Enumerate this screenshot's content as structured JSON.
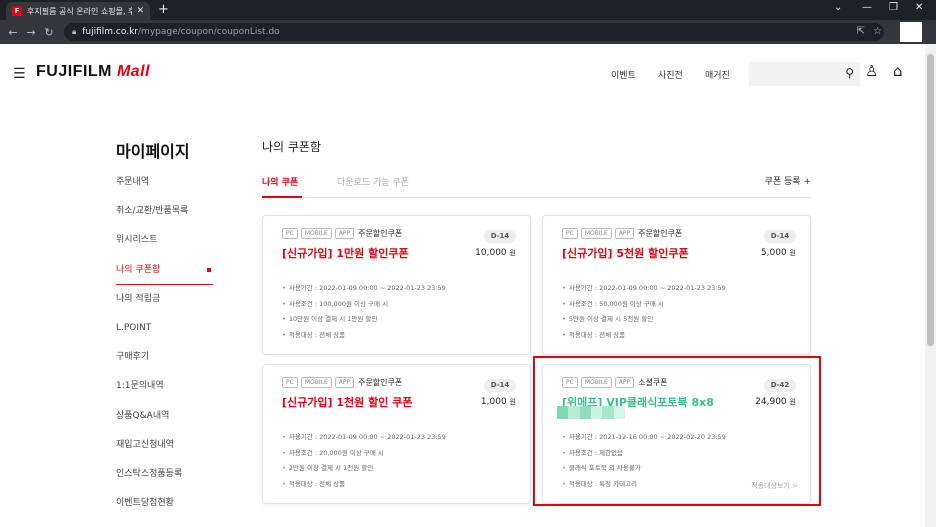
{
  "browser": {
    "tab_title": "후지필름 공식 온라인 쇼핑몰, 후",
    "tab_favicon": "F",
    "url_host": "fujifilm.co.kr",
    "url_path": "/mypage/coupon/couponList.do"
  },
  "header": {
    "logo_main": "FUJIFILM",
    "logo_mall": "Mall",
    "nav": [
      "이벤트",
      "사진전",
      "매거진"
    ]
  },
  "sidebar": {
    "title": "마이페이지",
    "items": [
      "주문내역",
      "취소/교환/반품목록",
      "위시리스트",
      "나의 쿠폰함",
      "나의 적립금",
      "L.POINT",
      "구매후기",
      "1:1문의내역",
      "상품Q&A내역",
      "재입고신청내역",
      "인스탁스정품등록",
      "이벤트당첨현황"
    ],
    "active_index": 3
  },
  "main": {
    "title": "나의 쿠폰함",
    "tabs": [
      "나의 쿠폰",
      "다운로드 가능 쿠폰"
    ],
    "register": "쿠폰 등록 +"
  },
  "coupons": [
    {
      "platforms": [
        "PC",
        "MOBILE",
        "APP"
      ],
      "type": "주문할인쿠폰",
      "dday": "D-14",
      "name": "[신규가입] 1만원 할인쿠폰",
      "amount": "10,000",
      "unit": "원",
      "details": [
        "사용기간 : 2022-01-09 00:00 ~ 2022-01-23 23:59",
        "사용조건 : 100,000원 이상 구매 시",
        "10만원 이상 결제 시 1만원 할인",
        "적용대상 : 전체 상품"
      ]
    },
    {
      "platforms": [
        "PC",
        "MOBILE",
        "APP"
      ],
      "type": "주문할인쿠폰",
      "dday": "D-14",
      "name": "[신규가입] 5천원 할인쿠폰",
      "amount": "5,000",
      "unit": "원",
      "details": [
        "사용기간 : 2022-01-09 00:00 ~ 2022-01-23 23:59",
        "사용조건 : 50,000원 이상 구매 시",
        "5만원 이상 결제 시 5천원 할인",
        "적용대상 : 전체 상품"
      ]
    },
    {
      "platforms": [
        "PC",
        "MOBILE",
        "APP"
      ],
      "type": "주문할인쿠폰",
      "dday": "D-14",
      "name": "[신규가입] 1천원 할인 쿠폰",
      "amount": "1,000",
      "unit": "원",
      "details": [
        "사용기간 : 2022-01-09 00:00 ~ 2022-01-23 23:59",
        "사용조건 : 20,000원 이상 구매 시",
        "2만원 이상 결제 시 1천원 할인",
        "적용대상 : 전체 상품"
      ]
    },
    {
      "platforms": [
        "PC",
        "MOBILE",
        "APP"
      ],
      "type": "소셜쿠폰",
      "dday": "D-42",
      "name": "[위메프] VIP클래식포토북 8x8",
      "amount": "24,900",
      "unit": "원",
      "details": [
        "사용기간 : 2021-12-16 00:00 ~ 2022-02-20 23:59",
        "사용조건 : 제한없음",
        "클래식 포토북 외 사용불가",
        "적용대상 : 특정 카테고리"
      ],
      "scope_link": "적용대상보기 >"
    }
  ],
  "colors": {
    "accent": "#e60012",
    "social": "#3dbd8a",
    "highlight_box": "#e60012"
  }
}
